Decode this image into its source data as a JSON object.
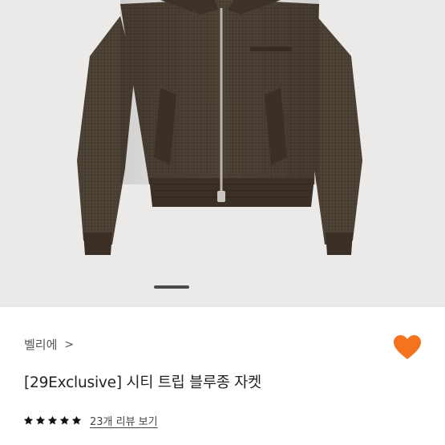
{
  "product": {
    "brand": "벨리에",
    "brand_chevron": ">",
    "title": "[29Exclusive] 시티 트립 블루종 자켓",
    "rating": {
      "stars": 5,
      "max": 5
    },
    "review_link": "23개 리뷰 보기"
  },
  "image_carousel": {
    "indicator": "active"
  },
  "colors": {
    "heart": "#f5731e",
    "star": "#111111",
    "jacket": "#4a3f33"
  },
  "icons": {
    "wishlist": "heart-icon",
    "rating": "star-icon",
    "brand_link": "chevron-right-icon"
  }
}
